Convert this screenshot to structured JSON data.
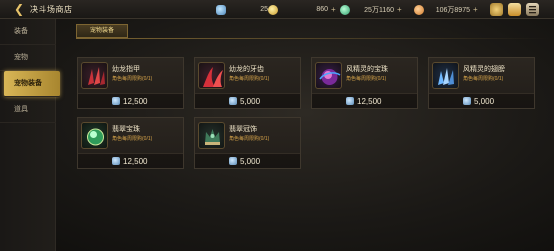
{
  "header": {
    "title": "决斗场商店",
    "resources": [
      {
        "icon": "gem-icon",
        "value": "25",
        "plus": "+"
      },
      {
        "icon": "coin-icon",
        "value": "860",
        "plus": "+"
      },
      {
        "icon": "green-crystal-icon",
        "value": "25万1160",
        "plus": "+"
      },
      {
        "icon": "gold-coin-icon",
        "value": "106万8975",
        "plus": "+"
      }
    ]
  },
  "sidebar": {
    "items": [
      {
        "label": "装备"
      },
      {
        "label": "宠物"
      },
      {
        "label": "宠物装备"
      },
      {
        "label": "道具"
      }
    ],
    "active_index": 2
  },
  "category_tab": {
    "label": "宠物装备"
  },
  "items": [
    {
      "name": "幼龙指甲",
      "limit": "角色每周限购(0/1)",
      "price": "12,500",
      "icon": "dragon-claw-icon"
    },
    {
      "name": "幼龙的牙齿",
      "limit": "角色每周限购(0/1)",
      "price": "5,000",
      "icon": "dragon-tooth-icon"
    },
    {
      "name": "风精灵的宝珠",
      "limit": "角色每周限购(0/1)",
      "price": "12,500",
      "icon": "wind-orb-icon"
    },
    {
      "name": "风精灵的翅膀",
      "limit": "角色每周限购(0/1)",
      "price": "5,000",
      "icon": "wind-wing-icon"
    },
    {
      "name": "翡翠宝珠",
      "limit": "角色每周限购(0/1)",
      "price": "12,500",
      "icon": "jade-orb-icon"
    },
    {
      "name": "翡翠冠饰",
      "limit": "角色每周限购(0/1)",
      "price": "5,000",
      "icon": "jade-crown-icon"
    }
  ],
  "colors": {
    "accent_gold": "#d9b656",
    "limit_text": "#d6a44a",
    "card_bg": "#2b2620"
  }
}
